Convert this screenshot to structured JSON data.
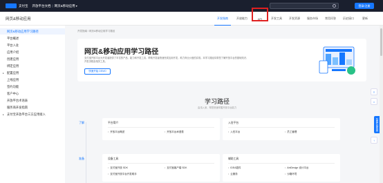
{
  "topbar": {
    "logo_text": "支付宝",
    "doc_title": "开放平台文档",
    "separator": "|",
    "current_doc": "网页&移动应用",
    "login_label": "登录/注册"
  },
  "navbar": {
    "brand": "网页&移动应用",
    "tabs": [
      {
        "label": "开发指南",
        "active": true
      },
      {
        "label": "开放能力",
        "active": false
      },
      {
        "label": "API",
        "active": false
      },
      {
        "label": "开发工具",
        "active": false
      },
      {
        "label": "开发资源",
        "active": false
      },
      {
        "label": "服务市场",
        "active": false
      },
      {
        "label": "常用问答",
        "active": false
      },
      {
        "label": "历史接口",
        "active": false
      },
      {
        "label": "更新",
        "active": false
      }
    ]
  },
  "sidebar": {
    "items": [
      {
        "label": "网页&移动应用学习路径",
        "active": true
      },
      {
        "label": "平台概述"
      },
      {
        "label": "平台入驻"
      },
      {
        "label": "应用介绍"
      },
      {
        "label": "创建应用"
      },
      {
        "label": "绑定应用"
      },
      {
        "label": "配置应用",
        "expandable": true
      },
      {
        "label": "上线应用"
      },
      {
        "label": "签约功能"
      },
      {
        "label": "客户中心"
      },
      {
        "label": "开放平台术语表"
      },
      {
        "label": "服务商开发指南"
      },
      {
        "label": "支付宝开放平台三方应用接入",
        "expandable": true
      }
    ]
  },
  "breadcrumb": "开发指南 / 网页&移动应用学习路径",
  "hero": {
    "title": "网页&移动应用学习路径",
    "description": "支付宝开放平台为开发者提供了丰富的产品、能力和开发工具，帮助开发者快速完成应用开发，助力商业价值的实现。本学习路径将带您了解开放平台的基础知识、开发流程及相关工具。",
    "button_label": "快速开始 DEMO"
  },
  "section": {
    "title": "学习路径",
    "subtitle": "由浅入深，帮您快速掌握开放平台能力"
  },
  "stages": [
    {
      "label": "了解",
      "cards": [
        {
          "title": "平台简介",
          "links": [
            "开放平台概述",
            "开放平台术语表"
          ]
        },
        {
          "title": "入驻平台",
          "links": [
            "入驻平台",
            "员工管理"
          ]
        }
      ]
    },
    {
      "label": "准备",
      "cards": [
        {
          "title": "设备工具",
          "links": [
            "支付宝开放 SDK",
            "支付宝客户端 SDK",
            "支付宝开放平台开发助手"
          ]
        },
        {
          "title": "辅助工具",
          "links": [
            "IDEA插件",
            "AntDesign 设计平台",
            "云服务",
            "沙箱环境"
          ]
        }
      ]
    }
  ],
  "floating": {
    "btn1": "≡",
    "btn2": "⌂",
    "side_tab": "智能在线客服",
    "btn3": "↑"
  }
}
